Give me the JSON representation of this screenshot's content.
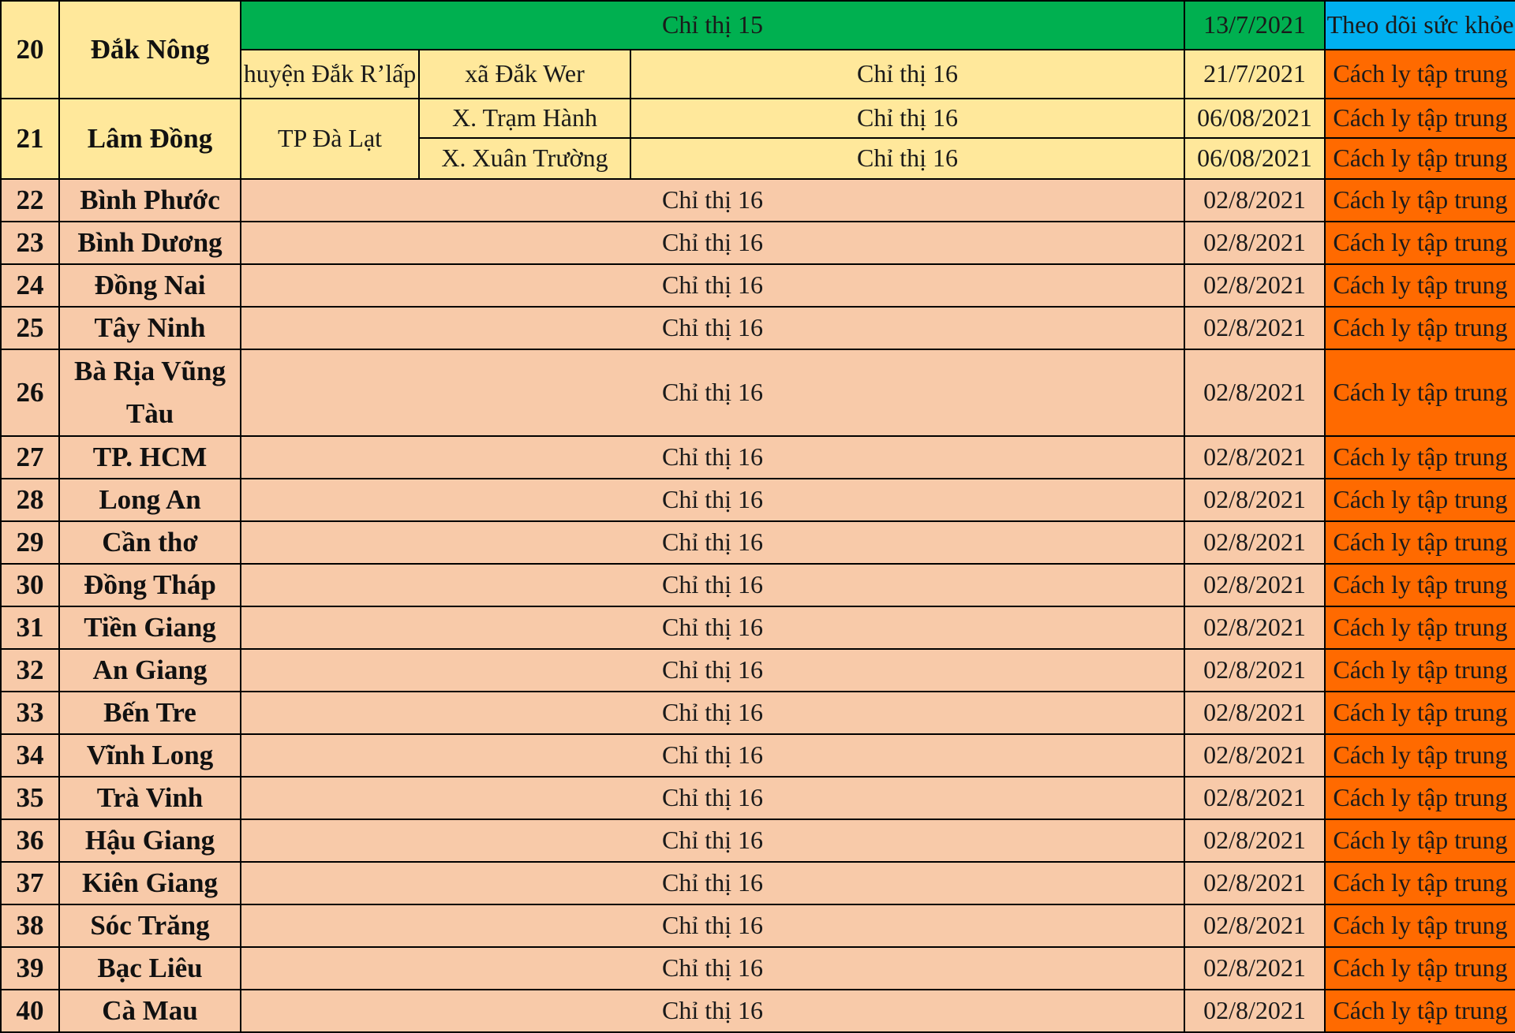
{
  "table": {
    "colors": {
      "yellow": "#ffe89b",
      "peach": "#f8caa9",
      "green": "#00b050",
      "blue": "#00b0f0",
      "orange": "#ff6a00"
    },
    "top_rows": {
      "dak_nong": {
        "no": "20",
        "province": "Đắk Nông",
        "province_condition": "Chỉ thị 15",
        "province_date": "13/7/2021",
        "province_measure": "Theo dõi sức khỏe",
        "district": "huyện Đắk R’lấp",
        "commune": "xã Đắk Wer",
        "condition": "Chỉ thị 16",
        "date": "21/7/2021",
        "measure": "Cách ly tập trung"
      },
      "lam_dong": {
        "no": "21",
        "province": "Lâm Đồng",
        "district": "TP Đà Lạt",
        "communes": [
          {
            "name": "X. Trạm Hành",
            "condition": "Chỉ thị 16",
            "date": "06/08/2021",
            "measure": "Cách ly tập trung"
          },
          {
            "name": "X. Xuân Trường",
            "condition": "Chỉ thị 16",
            "date": "06/08/2021",
            "measure": "Cách ly tập trung"
          }
        ]
      }
    },
    "rows": [
      {
        "no": "22",
        "province": "Bình Phước",
        "condition": "Chỉ thị 16",
        "date": "02/8/2021",
        "measure": "Cách ly tập trung"
      },
      {
        "no": "23",
        "province": "Bình Dương",
        "condition": "Chỉ thị 16",
        "date": "02/8/2021",
        "measure": "Cách ly tập trung"
      },
      {
        "no": "24",
        "province": "Đồng Nai",
        "condition": "Chỉ thị 16",
        "date": "02/8/2021",
        "measure": "Cách ly tập trung"
      },
      {
        "no": "25",
        "province": "Tây Ninh",
        "condition": "Chỉ thị 16",
        "date": "02/8/2021",
        "measure": "Cách ly tập trung"
      },
      {
        "no": "26",
        "province": "Bà Rịa Vũng Tàu",
        "condition": "Chỉ thị 16",
        "date": "02/8/2021",
        "measure": "Cách ly tập trung"
      },
      {
        "no": "27",
        "province": "TP. HCM",
        "condition": "Chỉ thị 16",
        "date": "02/8/2021",
        "measure": "Cách ly tập trung"
      },
      {
        "no": "28",
        "province": "Long An",
        "condition": "Chỉ thị 16",
        "date": "02/8/2021",
        "measure": "Cách ly tập trung"
      },
      {
        "no": "29",
        "province": "Cần thơ",
        "condition": "Chỉ thị 16",
        "date": "02/8/2021",
        "measure": "Cách ly tập trung"
      },
      {
        "no": "30",
        "province": "Đồng Tháp",
        "condition": "Chỉ thị 16",
        "date": "02/8/2021",
        "measure": "Cách ly tập trung"
      },
      {
        "no": "31",
        "province": "Tiền Giang",
        "condition": "Chỉ thị 16",
        "date": "02/8/2021",
        "measure": "Cách ly tập trung"
      },
      {
        "no": "32",
        "province": "An Giang",
        "condition": "Chỉ thị 16",
        "date": "02/8/2021",
        "measure": "Cách ly tập trung"
      },
      {
        "no": "33",
        "province": "Bến Tre",
        "condition": "Chỉ thị 16",
        "date": "02/8/2021",
        "measure": "Cách ly tập trung"
      },
      {
        "no": "34",
        "province": "Vĩnh Long",
        "condition": "Chỉ thị 16",
        "date": "02/8/2021",
        "measure": "Cách ly tập trung"
      },
      {
        "no": "35",
        "province": "Trà Vinh",
        "condition": "Chỉ thị 16",
        "date": "02/8/2021",
        "measure": "Cách ly tập trung"
      },
      {
        "no": "36",
        "province": "Hậu Giang",
        "condition": "Chỉ thị 16",
        "date": "02/8/2021",
        "measure": "Cách ly tập trung"
      },
      {
        "no": "37",
        "province": "Kiên Giang",
        "condition": "Chỉ thị 16",
        "date": "02/8/2021",
        "measure": "Cách ly tập trung"
      },
      {
        "no": "38",
        "province": "Sóc Trăng",
        "condition": "Chỉ thị 16",
        "date": "02/8/2021",
        "measure": "Cách ly tập trung"
      },
      {
        "no": "39",
        "province": "Bạc Liêu",
        "condition": "Chỉ thị 16",
        "date": "02/8/2021",
        "measure": "Cách ly tập trung"
      },
      {
        "no": "40",
        "province": "Cà Mau",
        "condition": "Chỉ thị 16",
        "date": "02/8/2021",
        "measure": "Cách ly tập trung"
      }
    ]
  }
}
